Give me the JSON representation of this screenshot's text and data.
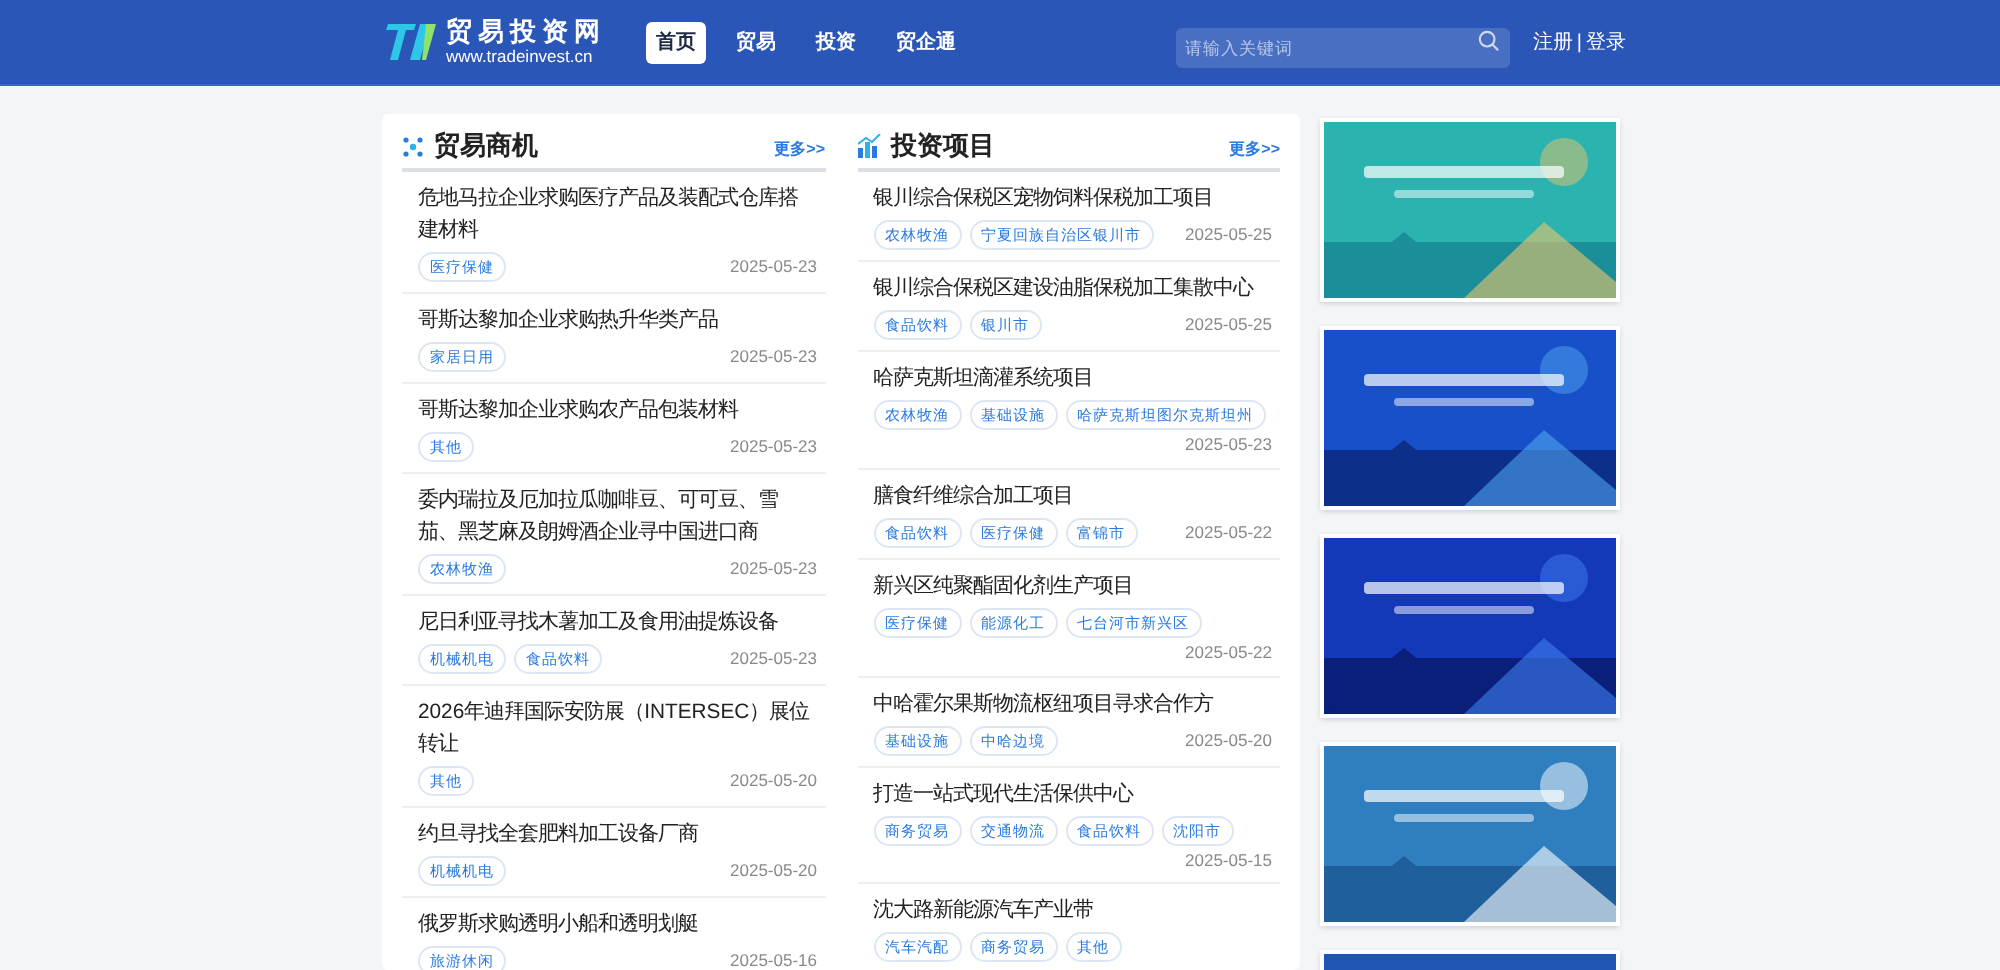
{
  "header": {
    "logo_title": "贸易投资网",
    "logo_url": "www.tradeinvest.cn",
    "nav": [
      {
        "label": "首页",
        "selected": true
      },
      {
        "label": "贸易",
        "selected": false
      },
      {
        "label": "投资",
        "selected": false
      },
      {
        "label": "贸企通",
        "selected": false
      }
    ],
    "search": {
      "placeholder": "请输入关键词"
    },
    "register": "注册",
    "separator": "|",
    "login": "登录"
  },
  "sections": [
    {
      "kind": "trade",
      "title": "贸易商机",
      "more": "更多>>",
      "items": [
        {
          "title": "危地马拉企业求购医疗产品及装配式仓库搭建材料",
          "tags": [
            "医疗保健"
          ],
          "date": "2025-05-23"
        },
        {
          "title": "哥斯达黎加企业求购热升华类产品",
          "tags": [
            "家居日用"
          ],
          "date": "2025-05-23"
        },
        {
          "title": "哥斯达黎加企业求购农产品包装材料",
          "tags": [
            "其他"
          ],
          "date": "2025-05-23"
        },
        {
          "title": "委内瑞拉及厄加拉瓜咖啡豆、可可豆、雪茄、黑芝麻及朗姆酒企业寻中国进口商",
          "tags": [
            "农林牧渔"
          ],
          "date": "2025-05-23"
        },
        {
          "title": "尼日利亚寻找木薯加工及食用油提炼设备",
          "tags": [
            "机械机电",
            "食品饮料"
          ],
          "date": "2025-05-23"
        },
        {
          "title": "2026年迪拜国际安防展（INTERSEC）展位转让",
          "tags": [
            "其他"
          ],
          "date": "2025-05-20"
        },
        {
          "title": "约旦寻找全套肥料加工设备厂商",
          "tags": [
            "机械机电"
          ],
          "date": "2025-05-20"
        },
        {
          "title": "俄罗斯求购透明小船和透明划艇",
          "tags": [
            "旅游休闲"
          ],
          "date": "2025-05-16"
        }
      ]
    },
    {
      "kind": "invest",
      "title": "投资项目",
      "more": "更多>>",
      "items": [
        {
          "title": "银川综合保税区宠物饲料保税加工项目",
          "tags": [
            "农林牧渔",
            "宁夏回族自治区银川市"
          ],
          "date": "2025-05-25"
        },
        {
          "title": "银川综合保税区建设油脂保税加工集散中心",
          "tags": [
            "食品饮料",
            "银川市"
          ],
          "date": "2025-05-25"
        },
        {
          "title": "哈萨克斯坦滴灌系统项目",
          "tags": [
            "农林牧渔",
            "基础设施",
            "哈萨克斯坦图尔克斯坦州"
          ],
          "date": "2025-05-23"
        },
        {
          "title": "膳食纤维综合加工项目",
          "tags": [
            "食品饮料",
            "医疗保健",
            "富锦市"
          ],
          "date": "2025-05-22"
        },
        {
          "title": "新兴区纯聚酯固化剂生产项目",
          "tags": [
            "医疗保健",
            "能源化工",
            "七台河市新兴区"
          ],
          "date": "2025-05-22"
        },
        {
          "title": "中哈霍尔果斯物流枢纽项目寻求合作方",
          "tags": [
            "基础设施",
            "中哈边境"
          ],
          "date": "2025-05-20"
        },
        {
          "title": "打造一站式现代生活保供中心",
          "tags": [
            "商务贸易",
            "交通物流",
            "食品饮料",
            "沈阳市"
          ],
          "date": "2025-05-15"
        },
        {
          "title": "沈大路新能源汽车产业带",
          "tags": [
            "汽车汽配",
            "商务贸易",
            "其他"
          ]
        }
      ]
    }
  ]
}
